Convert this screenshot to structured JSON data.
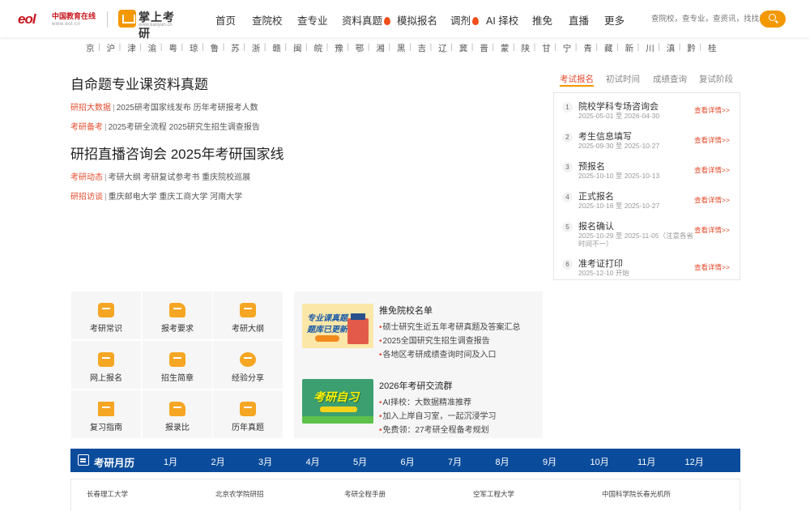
{
  "header": {
    "eol_logo_mark": "eol",
    "eol_logo_name": "中国教育在线",
    "eol_logo_url": "www.eol.cn",
    "ky_logo_title": "掌上考研",
    "ky_logo_url": "www.kaoyan.cn",
    "nav": [
      {
        "label": "首页",
        "hot": false
      },
      {
        "label": "查院校",
        "hot": false
      },
      {
        "label": "查专业",
        "hot": false
      },
      {
        "label": "资料真题",
        "hot": true
      },
      {
        "label": "模拟报名",
        "hot": false
      },
      {
        "label": "调剂",
        "hot": true
      },
      {
        "label": "AI 择校",
        "hot": false
      },
      {
        "label": "推免",
        "hot": false
      },
      {
        "label": "直播",
        "hot": false
      },
      {
        "label": "更多",
        "hot": false
      }
    ],
    "search_placeholder": "查院校，查专业，查资讯，找找看"
  },
  "provinces": [
    "京",
    "沪",
    "津",
    "渝",
    "粤",
    "琼",
    "鲁",
    "苏",
    "浙",
    "赣",
    "闽",
    "皖",
    "豫",
    "鄂",
    "湘",
    "黑",
    "吉",
    "辽",
    "冀",
    "晋",
    "蒙",
    "陕",
    "甘",
    "宁",
    "青",
    "藏",
    "新",
    "川",
    "滇",
    "黔",
    "桂"
  ],
  "news": {
    "title1": "自命题专业课资料真题",
    "line1": {
      "tag": "研招大数据",
      "text": "2025研考国家线发布 历年考研报考人数"
    },
    "line2": {
      "tag": "考研备考",
      "text": "2025考研全流程 2025研究生招生调查报告"
    },
    "title2": "研招直播咨询会 2025年考研国家线",
    "line3": {
      "tag": "考研动态",
      "text": "考研大纲 考研复试参考书 重庆院校巡展"
    },
    "line4": {
      "tag": "研招访谈",
      "text": "重庆邮电大学 重庆工商大学 河南大学"
    }
  },
  "exam_tabs": [
    "考试报名",
    "初试时间",
    "成绩查询",
    "复试阶段"
  ],
  "exam_items": [
    {
      "num": "1",
      "name": "院校学科专场咨询会",
      "date": "2025-05-01 至 2026-04-30",
      "link": "查看详情>>"
    },
    {
      "num": "2",
      "name": "考生信息填写",
      "date": "2025-09-30 至 2025-10-27",
      "link": "查看详情>>"
    },
    {
      "num": "3",
      "name": "预报名",
      "date": "2025-10-10 至 2025-10-13",
      "link": "查看详情>>"
    },
    {
      "num": "4",
      "name": "正式报名",
      "date": "2025-10-16 至 2025-10-27",
      "link": "查看详情>>"
    },
    {
      "num": "5",
      "name": "报名确认",
      "date": "2025-10-29 至 2025-11-05（注意各省时间不一）",
      "link": "查看详情>>"
    },
    {
      "num": "6",
      "name": "准考证打印",
      "date": "2025-12-10 开始",
      "link": "查看详情>>"
    }
  ],
  "quick_links": [
    {
      "label": "考研常识",
      "icon": "envelope-icon"
    },
    {
      "label": "报考要求",
      "icon": "pencil-icon"
    },
    {
      "label": "考研大纲",
      "icon": "calendar-icon"
    },
    {
      "label": "网上报名",
      "icon": "id-card-icon"
    },
    {
      "label": "招生简章",
      "icon": "search-doc-icon"
    },
    {
      "label": "经验分享",
      "icon": "star-icon"
    },
    {
      "label": "复习指南",
      "icon": "flag-icon"
    },
    {
      "label": "报录比",
      "icon": "document-icon"
    },
    {
      "label": "历年真题",
      "icon": "clipboard-icon"
    }
  ],
  "promo": {
    "img1_line1": "专业课真题",
    "img1_line2": "题库已更新",
    "block1_title": "推免院校名单",
    "block1_lines": [
      "硕士研究生近五年考研真题及答案汇总",
      "2025全国研究生招生调查报告",
      "各地区考研成绩查询时间及入口"
    ],
    "img2_text": "考研自习",
    "block2_title": "2026年考研交流群",
    "block2_lines": [
      "AI择校：大数据精准推荐",
      "加入上岸自习室，一起沉浸学习",
      "免费领：27考研全程备考规划"
    ]
  },
  "calendar": {
    "title": "考研月历",
    "months": [
      "1月",
      "2月",
      "3月",
      "4月",
      "5月",
      "6月",
      "7月",
      "8月",
      "9月",
      "10月",
      "11月",
      "12月"
    ],
    "entries": [
      "长春理工大学",
      "北京农学院研招",
      "考研全程手册",
      "空军工程大学",
      "中国科学院长春光机所"
    ]
  },
  "colors": {
    "accent": "#f39800",
    "tag_red": "#e34c2d",
    "calendar_blue": "#0a4b9b",
    "eol_red": "#c8161d"
  }
}
